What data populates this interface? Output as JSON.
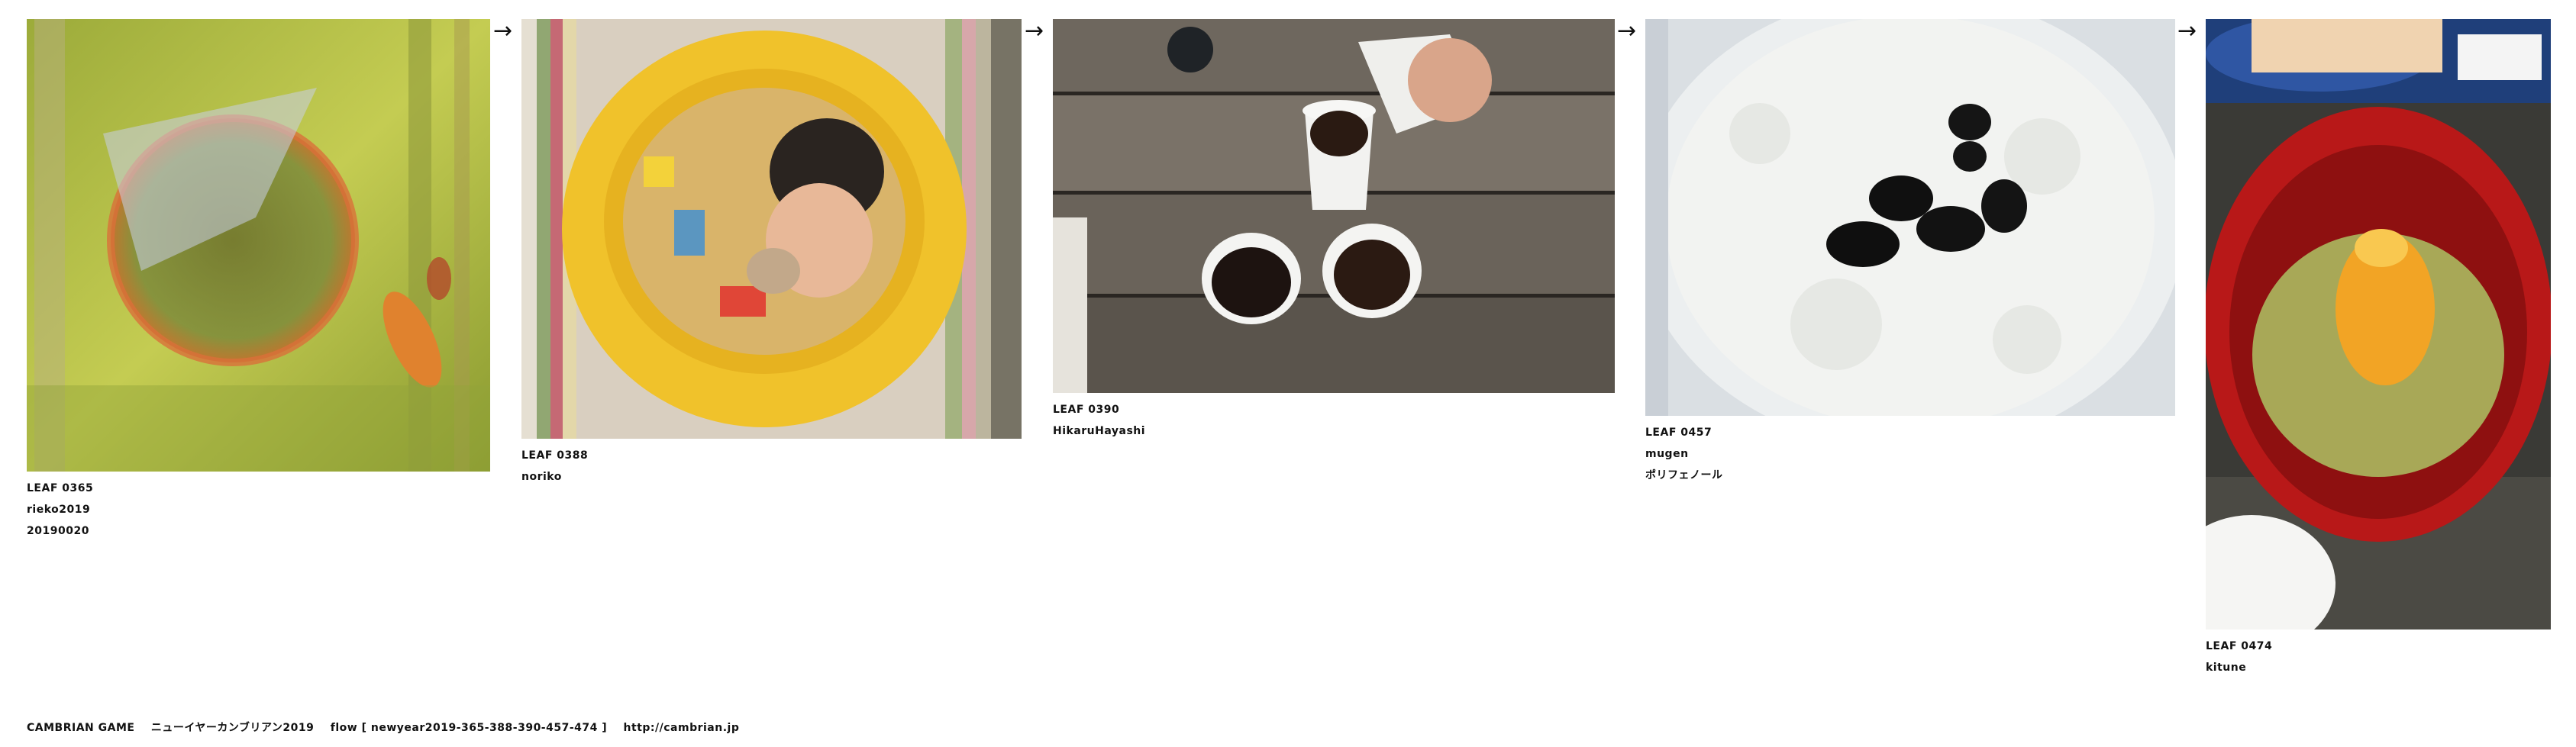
{
  "leaves": [
    {
      "id": "LEAF 0365",
      "author": "rieko2019",
      "extra": "20190020",
      "subject": "pond-collage-photo"
    },
    {
      "id": "LEAF 0388",
      "author": "noriko",
      "extra": "",
      "subject": "baby-in-pool-photo"
    },
    {
      "id": "LEAF 0390",
      "author": "HikaruHayashi",
      "extra": "",
      "subject": "coffee-cups-photo"
    },
    {
      "id": "LEAF 0457",
      "author": "mugen",
      "extra": "ポリフェノール",
      "subject": "rice-porridge-photo"
    },
    {
      "id": "LEAF 0474",
      "author": "kitune",
      "extra": "",
      "subject": "red-bowl-food-photo"
    }
  ],
  "arrow_glyph": "→",
  "footer": {
    "label": "CAMBRIAN GAME",
    "title": "ニューイヤーカンブリアン2019",
    "flow": "flow [ newyear2019-365-388-390-457-474 ]",
    "url": "http://cambrian.jp"
  }
}
